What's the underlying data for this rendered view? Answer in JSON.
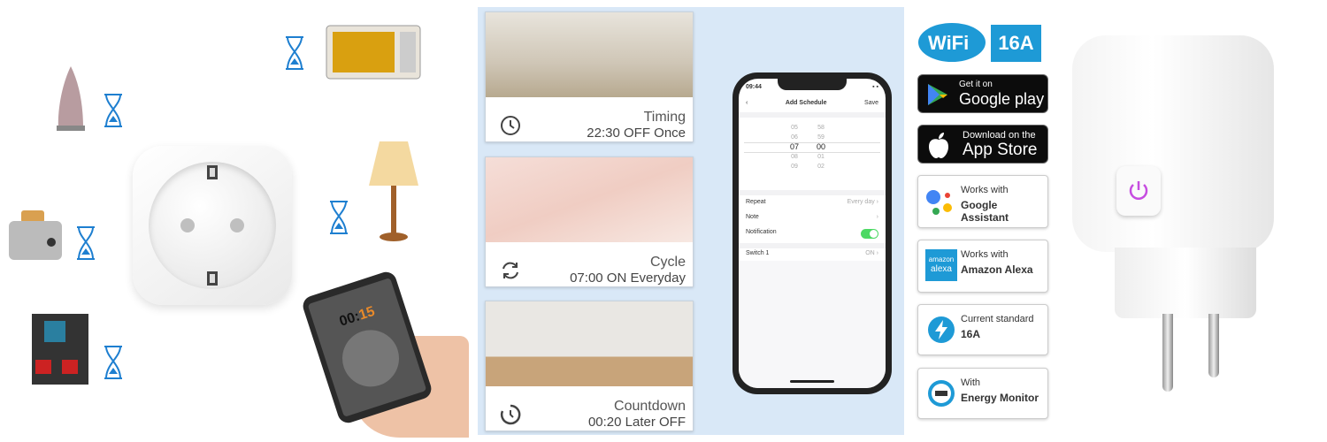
{
  "left_panel": {
    "phone_timer": {
      "hours": "00",
      "minutes": "15"
    }
  },
  "modes": [
    {
      "title": "Timing",
      "detail": "22:30 OFF Once",
      "icon": "clock-icon"
    },
    {
      "title": "Cycle",
      "detail": "07:00 ON Everyday",
      "icon": "cycle-icon"
    },
    {
      "title": "Countdown",
      "detail": "00:20 Later OFF",
      "icon": "countdown-icon"
    }
  ],
  "app": {
    "time": "09:44",
    "title": "Add Schedule",
    "save": "Save",
    "hours": [
      "05",
      "06",
      "07",
      "08",
      "09"
    ],
    "minutes": [
      "58",
      "59",
      "00",
      "01",
      "02"
    ],
    "rows": [
      {
        "label": "Repeat",
        "value": "Every day"
      },
      {
        "label": "Note",
        "value": ""
      },
      {
        "label": "Notification",
        "toggle": true
      },
      {
        "label": "Switch 1",
        "value": "ON"
      }
    ]
  },
  "badges": {
    "wifi": "WiFi",
    "amps": "16A",
    "google_play": {
      "line1": "Get it on",
      "line2": "Google play"
    },
    "app_store": {
      "line1": "Download on the",
      "line2": "App Store"
    },
    "features": [
      {
        "line1": "Works with",
        "line2": "Google Assistant",
        "icon": "google-assistant-icon"
      },
      {
        "line1": "Works with",
        "line2": "Amazon Alexa",
        "icon": "alexa-icon",
        "icon_text": "amazon alexa"
      },
      {
        "line1": "Current standard",
        "line2": "16A",
        "icon": "lightning-icon"
      },
      {
        "line1": "With",
        "line2": "Energy Monitor",
        "icon": "energy-meter-icon"
      }
    ]
  },
  "colors": {
    "accent": "#1e9ad6",
    "panel_bg": "#d9e8f7",
    "toggle": "#4cd964",
    "power": "#c64de0"
  }
}
